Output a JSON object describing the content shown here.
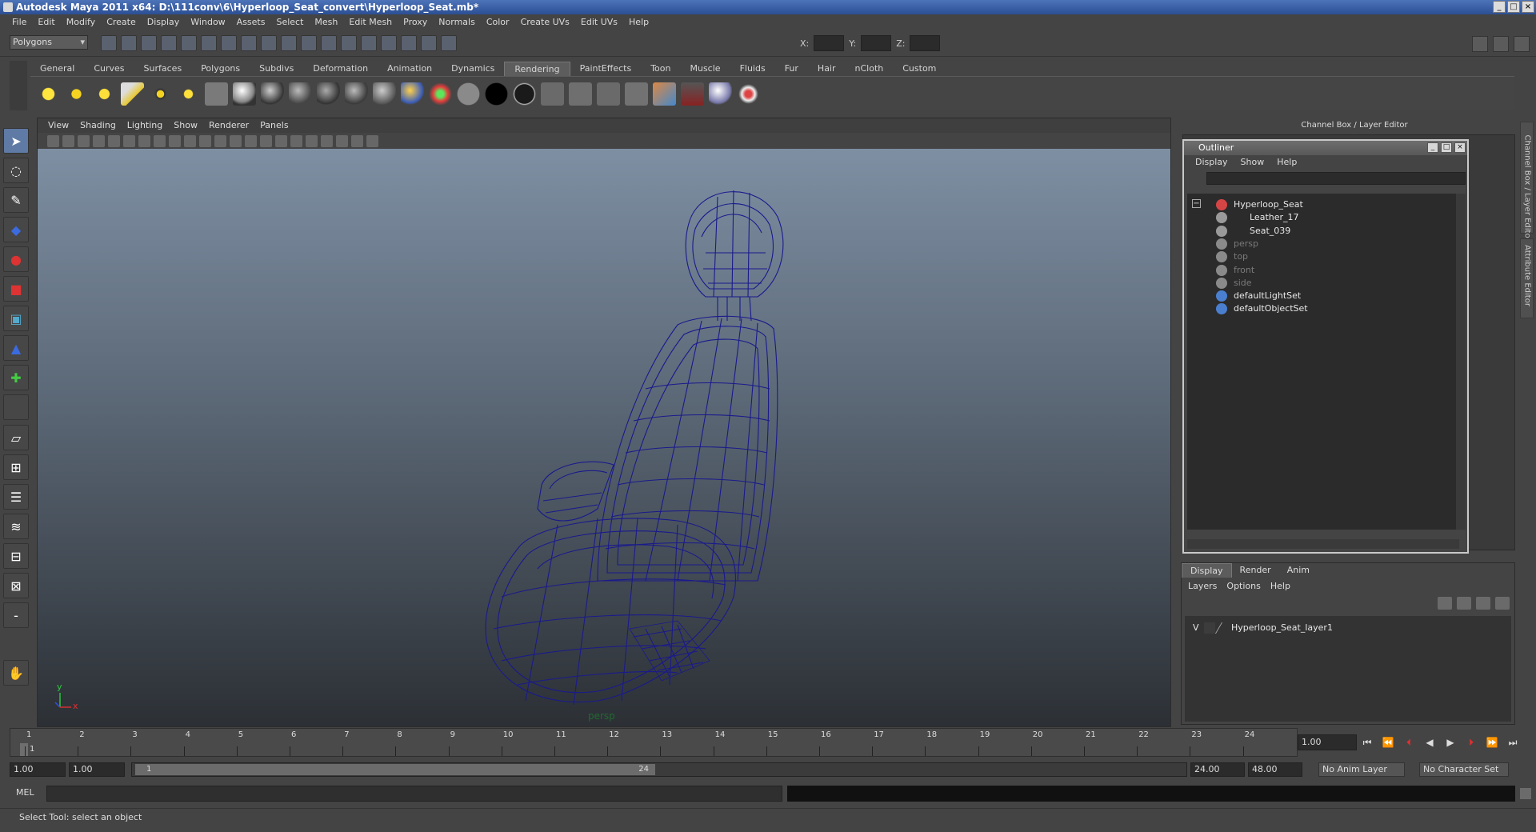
{
  "window": {
    "title": "Autodesk Maya 2011 x64: D:\\111conv\\6\\Hyperloop_Seat_convert\\Hyperloop_Seat.mb*"
  },
  "menus": [
    "File",
    "Edit",
    "Modify",
    "Create",
    "Display",
    "Window",
    "Assets",
    "Select",
    "Mesh",
    "Edit Mesh",
    "Proxy",
    "Normals",
    "Color",
    "Create UVs",
    "Edit UVs",
    "Help"
  ],
  "status": {
    "mode": "Polygons",
    "x_label": "X:",
    "y_label": "Y:",
    "z_label": "Z:"
  },
  "shelf": {
    "tabs": [
      "General",
      "Curves",
      "Surfaces",
      "Polygons",
      "Subdivs",
      "Deformation",
      "Animation",
      "Dynamics",
      "Rendering",
      "PaintEffects",
      "Toon",
      "Muscle",
      "Fluids",
      "Fur",
      "Hair",
      "nCloth",
      "Custom"
    ],
    "active_tab": "Rendering"
  },
  "viewport": {
    "menu": [
      "View",
      "Shading",
      "Lighting",
      "Show",
      "Renderer",
      "Panels"
    ],
    "camera": "persp",
    "axis_y": "y",
    "axis_x": "x",
    "wire_color": "#1a1a8c"
  },
  "channel_box": {
    "header": "Channel Box / Layer Editor"
  },
  "side_tabs": [
    "Channel Box / Layer Editor",
    "Attribute Editor"
  ],
  "outliner": {
    "title": "Outliner",
    "menu": [
      "Display",
      "Show",
      "Help"
    ],
    "items": [
      {
        "label": "Hyperloop_Seat",
        "indent": 0,
        "dim": false,
        "icon": "transform-icon"
      },
      {
        "label": "Leather_17",
        "indent": 1,
        "dim": false,
        "icon": "mesh-icon"
      },
      {
        "label": "Seat_039",
        "indent": 1,
        "dim": false,
        "icon": "mesh-icon"
      },
      {
        "label": "persp",
        "indent": 0,
        "dim": true,
        "icon": "camera-icon"
      },
      {
        "label": "top",
        "indent": 0,
        "dim": true,
        "icon": "camera-icon"
      },
      {
        "label": "front",
        "indent": 0,
        "dim": true,
        "icon": "camera-icon"
      },
      {
        "label": "side",
        "indent": 0,
        "dim": true,
        "icon": "camera-icon"
      },
      {
        "label": "defaultLightSet",
        "indent": 0,
        "dim": false,
        "icon": "set-icon"
      },
      {
        "label": "defaultObjectSet",
        "indent": 0,
        "dim": false,
        "icon": "set-icon"
      }
    ]
  },
  "layer_editor": {
    "tabs": [
      "Display",
      "Render",
      "Anim"
    ],
    "active_tab": "Display",
    "menu": [
      "Layers",
      "Options",
      "Help"
    ],
    "layers": [
      {
        "visible": "V",
        "name": "Hyperloop_Seat_layer1"
      }
    ]
  },
  "timeline": {
    "ticks": [
      "1",
      "2",
      "3",
      "4",
      "5",
      "6",
      "7",
      "8",
      "9",
      "10",
      "11",
      "12",
      "13",
      "14",
      "15",
      "16",
      "17",
      "18",
      "19",
      "20",
      "21",
      "22",
      "23",
      "24"
    ],
    "current_marker": "1",
    "current_frame": "1.00"
  },
  "range": {
    "start": "1.00",
    "inner_start": "1.00",
    "handle_start": "1",
    "handle_end": "24",
    "end": "24.00",
    "outer_end": "48.00",
    "anim_layer": "No Anim Layer",
    "character_set": "No Character Set"
  },
  "command": {
    "label": "MEL"
  },
  "help": {
    "text": "Select Tool: select an object"
  }
}
